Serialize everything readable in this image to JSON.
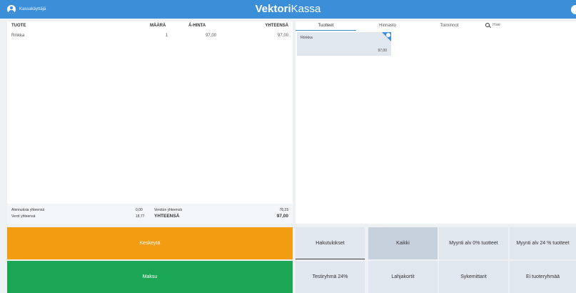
{
  "topbar": {
    "user_name": "Kassakäyttäjä",
    "brand_bold": "Vektori",
    "brand_light": "Kassa"
  },
  "receipt": {
    "columns": {
      "product": "TUOTE",
      "quantity": "MÄÄRÄ",
      "unit_price": "Á-HINTA",
      "total": "YHTEENSÄ"
    },
    "rows": [
      {
        "product": "Rinkka",
        "quantity": "1",
        "unit_price": "97,00",
        "total": "97,00"
      }
    ],
    "summary": {
      "discounts_label": "Alennuksia yhteensä",
      "discounts_value": "0,00",
      "taxes_label": "Verot yhteensä",
      "taxes_value": "18,77",
      "net_label": "Veroton yhteensä",
      "net_value": "78,23",
      "grand_label": "YHTEENSÄ",
      "grand_value": "97,00"
    }
  },
  "actions": {
    "cancel_label": "Keskeytä",
    "pay_label": "Maksu"
  },
  "products_panel": {
    "tabs": [
      "Tuotteet",
      "Hinnasto",
      "Toiminnot"
    ],
    "search_placeholder": "Hae",
    "tiles": [
      {
        "name": "Rinkka",
        "price": "97,00"
      }
    ]
  },
  "categories": [
    "Hakutulokset",
    "Kaikki",
    "Myynti alv 0% tuotteet",
    "Myynti alv 24 % tuotteet",
    "Testiryhmä 24%",
    "Lahjakortit",
    "Sykemittarit",
    "Ei tuoteryhmää"
  ],
  "colors": {
    "accent": "#3b8fd8",
    "cancel": "#f39c12",
    "pay": "#1aa653",
    "tile": "#e1e7ef",
    "selected": "#c7d1dc"
  }
}
